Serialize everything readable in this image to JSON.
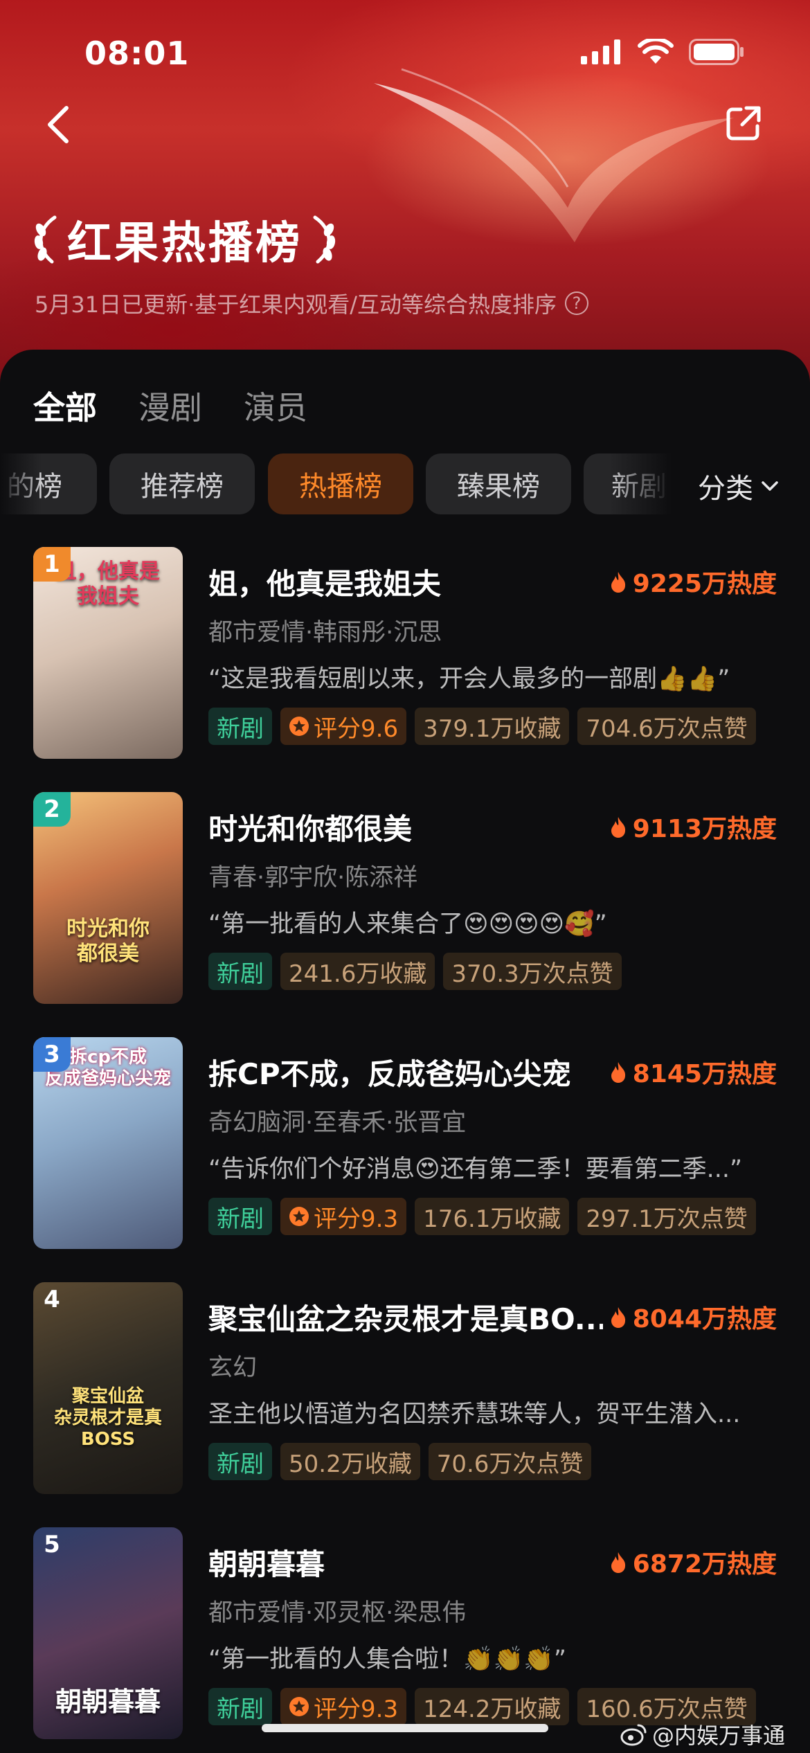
{
  "status": {
    "time": "08:01"
  },
  "header": {
    "title": "红果热播榜",
    "subtitle": "5月31日已更新·基于红果内观看/互动等综合热度排序",
    "help": "?"
  },
  "tabs": [
    {
      "label": "全部",
      "active": true
    },
    {
      "label": "漫剧",
      "active": false
    },
    {
      "label": "演员",
      "active": false
    }
  ],
  "chips": [
    {
      "label": "的榜",
      "active": false
    },
    {
      "label": "推荐榜",
      "active": false
    },
    {
      "label": "热播榜",
      "active": true
    },
    {
      "label": "臻果榜",
      "active": false
    },
    {
      "label": "新剧",
      "active": false
    }
  ],
  "category_label": "分类",
  "items": [
    {
      "rank": "1",
      "rank_color": "#f08a2c",
      "title": "姐，他真是我姐夫",
      "heat": "9225万热度",
      "genre": "都市爱情·韩雨彤·沉思",
      "quote": "“这是我看短剧以来，开会人最多的一部剧👍👍”",
      "tag_new": "新剧",
      "score": "评分9.6",
      "fav": "379.1万收藏",
      "likes": "704.6万次点赞",
      "poster_text": "且，他真是\n我姐夫",
      "poster_bg": "linear-gradient(160deg,#f3e6dc 0%,#d7c2b2 45%,#7b6a60 100%)"
    },
    {
      "rank": "2",
      "rank_color": "#24b39b",
      "title": "时光和你都很美",
      "heat": "9113万热度",
      "genre": "青春·郭宇欣·陈添祥",
      "quote": "“第一批看的人来集合了😍😍😍😍🥰”",
      "tag_new": "新剧",
      "score": "",
      "fav": "241.6万收藏",
      "likes": "370.3万次点赞",
      "poster_text": "时光和你\n都很美",
      "poster_bg": "linear-gradient(160deg,#f5c27a 0%,#c9774a 40%,#3b2620 100%)"
    },
    {
      "rank": "3",
      "rank_color": "#3a7bd5",
      "title": "拆CP不成，反成爸妈心尖宠",
      "heat": "8145万热度",
      "genre": "奇幻脑洞·至春禾·张晋宜",
      "quote": "“告诉你们个好消息😍还有第二季！要看第二季...”",
      "tag_new": "新剧",
      "score": "评分9.3",
      "fav": "176.1万收藏",
      "likes": "297.1万次点赞",
      "poster_text": "拆cp不成\n反成爸妈心尖宠",
      "poster_bg": "linear-gradient(160deg,#b9d6ee 0%,#8aa7c6 45%,#4e5a78 100%)"
    },
    {
      "rank": "4",
      "rank_color": "rgba(0,0,0,0)",
      "title": "聚宝仙盆之杂灵根才是真BO...",
      "heat": "8044万热度",
      "genre": "玄幻",
      "quote": "圣主他以悟道为名囚禁乔慧珠等人，贺平生潜入...",
      "tag_new": "新剧",
      "score": "",
      "fav": "50.2万收藏",
      "likes": "70.6万次点赞",
      "poster_text": "聚宝仙盆\n杂灵根才是真BOSS",
      "poster_bg": "linear-gradient(160deg,#5b4a32 0%,#2e2a22 50%,#1a1714 100%)"
    },
    {
      "rank": "5",
      "rank_color": "rgba(0,0,0,0)",
      "title": "朝朝暮暮",
      "heat": "6872万热度",
      "genre": "都市爱情·邓灵枢·梁思伟",
      "quote": "“第一批看的人集合啦！👏👏👏”",
      "tag_new": "新剧",
      "score": "评分9.3",
      "fav": "124.2万收藏",
      "likes": "160.6万次点赞",
      "poster_text": "朝朝暮暮",
      "poster_bg": "linear-gradient(160deg,#2d3e6a 0%,#5a3b58 50%,#1c1a2a 100%)"
    }
  ],
  "watermark": "@内娱万事通",
  "colors": {
    "accent": "#ff6a2b",
    "new_tag": "#3fcf9a"
  }
}
